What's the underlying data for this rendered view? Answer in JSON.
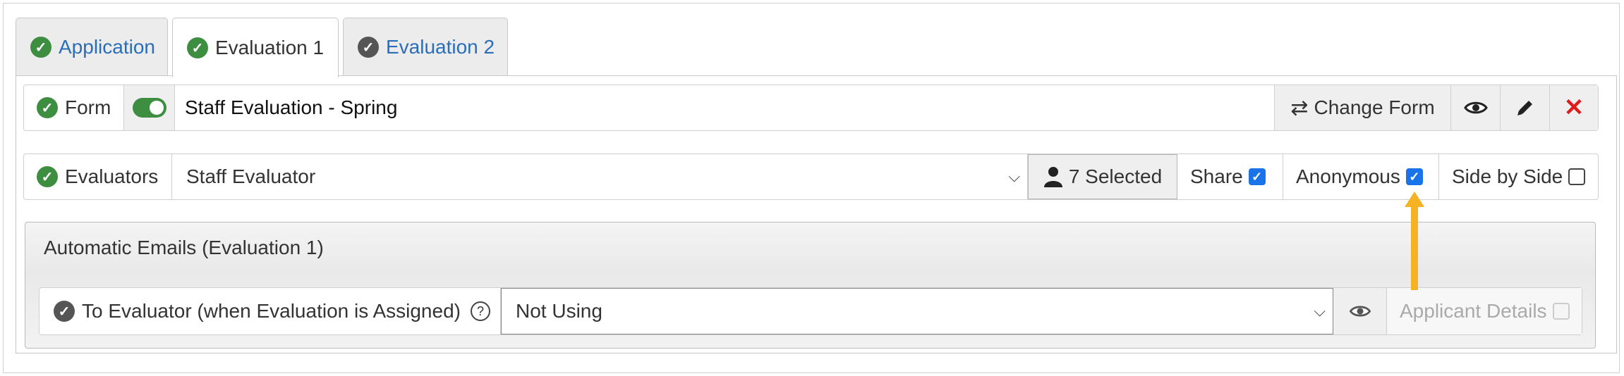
{
  "tabs": [
    {
      "label": "Application",
      "active": false
    },
    {
      "label": "Evaluation 1",
      "active": true
    },
    {
      "label": "Evaluation 2",
      "active": false
    }
  ],
  "form_row": {
    "label": "Form",
    "value": "Staff Evaluation - Spring",
    "change_label": "Change Form"
  },
  "evaluators_row": {
    "label": "Evaluators",
    "select_value": "Staff Evaluator",
    "selected_label": "7 Selected",
    "share_label": "Share",
    "share_checked": true,
    "anonymous_label": "Anonymous",
    "anonymous_checked": true,
    "side_by_side_label": "Side by Side",
    "side_by_side_checked": false
  },
  "automatic_emails": {
    "title": "Automatic Emails (Evaluation 1)",
    "to_evaluator_label": "To Evaluator (when Evaluation is Assigned)",
    "select_value": "Not Using",
    "applicant_details_label": "Applicant Details",
    "applicant_details_checked": false
  },
  "colors": {
    "accent_blue": "#2a6ebb",
    "success_green": "#3e8e41",
    "delete_red": "#e01b1b",
    "annotation_arrow": "#f5b323"
  }
}
